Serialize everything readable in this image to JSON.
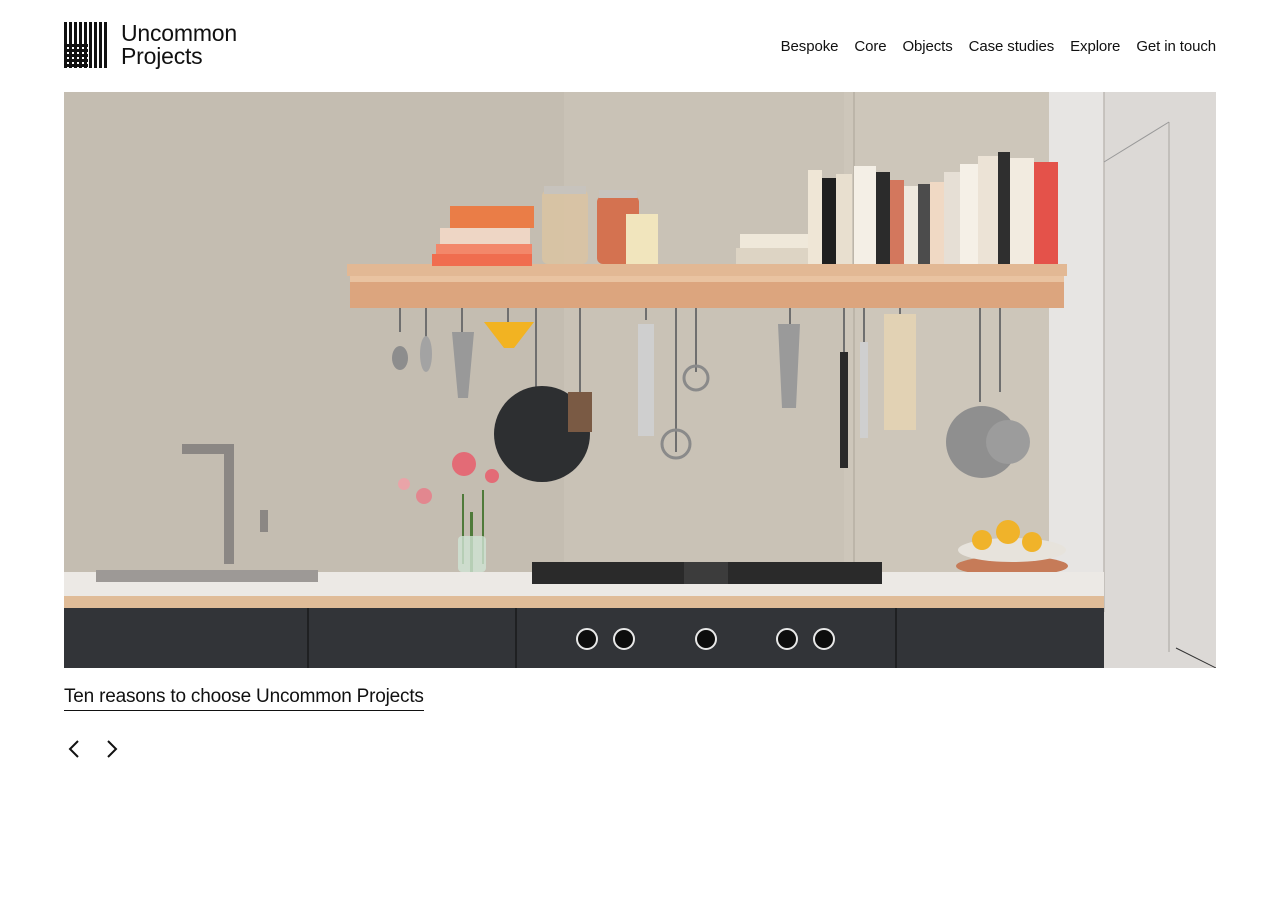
{
  "brand": {
    "name_line1": "Uncommon",
    "name_line2": "Projects",
    "icon": "barcode-logo-icon"
  },
  "nav": {
    "items": [
      {
        "label": "Bespoke"
      },
      {
        "label": "Core"
      },
      {
        "label": "Objects"
      },
      {
        "label": "Case studies"
      },
      {
        "label": "Explore"
      },
      {
        "label": "Get in touch"
      }
    ]
  },
  "hero": {
    "alt": "Kitchen with wooden shelf of books and jars, hanging utensils, concrete backsplash, marble counter and dark cabinets"
  },
  "slide": {
    "caption": "Ten reasons to choose Uncommon Projects"
  },
  "carousel": {
    "prev_icon": "chevron-left-icon",
    "next_icon": "chevron-right-icon"
  },
  "colors": {
    "text": "#111111",
    "background": "#ffffff"
  }
}
